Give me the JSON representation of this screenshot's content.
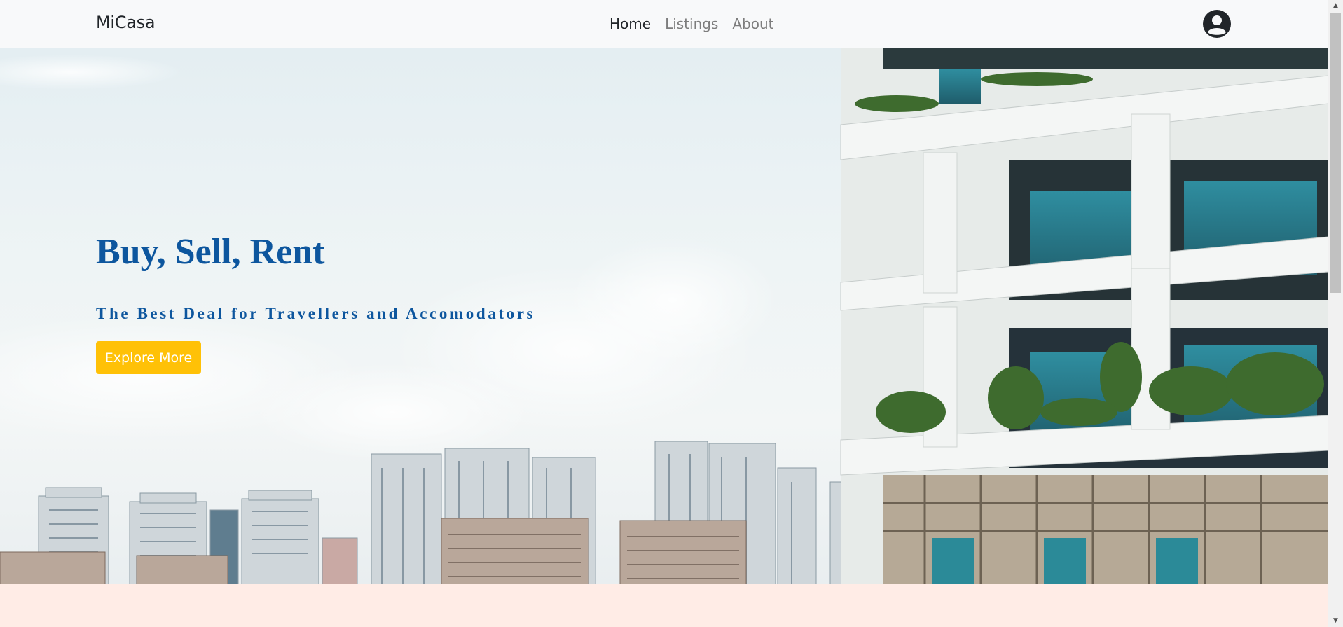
{
  "navbar": {
    "brand": "MiCasa",
    "links": [
      {
        "label": "Home",
        "active": true
      },
      {
        "label": "Listings",
        "active": false
      },
      {
        "label": "About",
        "active": false
      }
    ],
    "profile_icon": "user-circle-icon"
  },
  "hero": {
    "title": "Buy, Sell, Rent",
    "subtitle": "The Best Deal for Travellers and Accomodators",
    "cta_label": "Explore More"
  },
  "colors": {
    "brand_blue": "#0d569e",
    "cta_yellow": "#ffc107",
    "navbar_bg": "#f8f9fa",
    "section_bg": "#ffece6"
  },
  "scrollbar": {
    "up_icon": "triangle-up-icon",
    "down_icon": "triangle-down-icon"
  }
}
